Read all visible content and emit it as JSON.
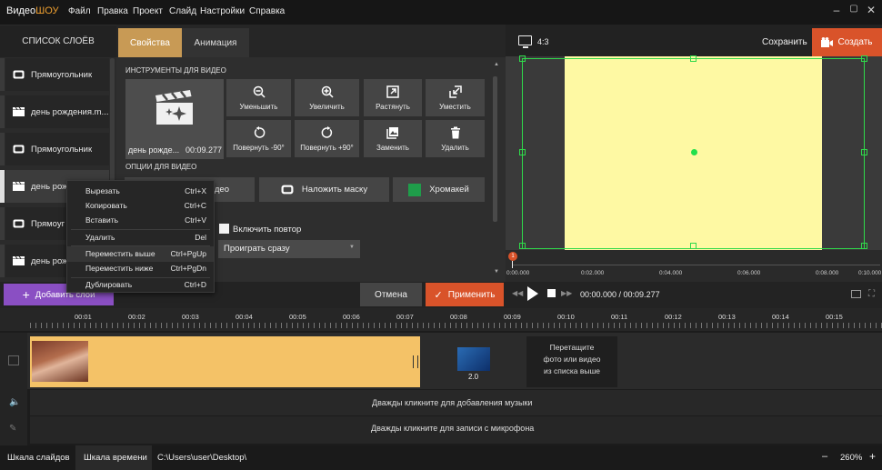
{
  "app": {
    "brand_part1": "Видео",
    "brand_part2": "ШОУ"
  },
  "menu": [
    "Файл",
    "Правка",
    "Проект",
    "Слайд",
    "Настройки",
    "Справка"
  ],
  "layers": {
    "title": "СПИСОК СЛОЁВ",
    "items": [
      {
        "label": "Прямоугольник",
        "icon": "rectangle-icon"
      },
      {
        "label": "день рождения.m...",
        "icon": "clapperboard-icon"
      },
      {
        "label": "Прямоугольник",
        "icon": "rectangle-icon"
      },
      {
        "label": "день рож",
        "icon": "clapperboard-icon"
      },
      {
        "label": "Прямоуг",
        "icon": "rectangle-icon"
      },
      {
        "label": "день рож",
        "icon": "clapperboard-icon"
      }
    ]
  },
  "tabs": {
    "properties": "Свойства",
    "animation": "Анимация"
  },
  "video_tools": {
    "title": "ИНСТРУМЕНТЫ ДЛЯ ВИДЕО",
    "clip_name": "день рожде...",
    "clip_time": "00:09.277",
    "buttons": [
      {
        "label": "Уменьшить",
        "icon": "zoom-out-icon"
      },
      {
        "label": "Увеличить",
        "icon": "zoom-in-icon"
      },
      {
        "label": "Растянуть",
        "icon": "stretch-icon"
      },
      {
        "label": "Уместить",
        "icon": "fit-icon"
      },
      {
        "label": "Повернуть -90°",
        "icon": "rotate-left-icon"
      },
      {
        "label": "Повернуть +90°",
        "icon": "rotate-right-icon"
      },
      {
        "label": "Заменить",
        "icon": "replace-icon"
      },
      {
        "label": "Удалить",
        "icon": "trash-icon"
      }
    ]
  },
  "video_options": {
    "title": "ОПЦИИ ДЛЯ ВИДЕО",
    "btn1_partial": "идео",
    "mask_label": "Наложить маску",
    "chroma_label": "Хромакей",
    "loop_label": "Включить повтор",
    "play_select": "Проиграть сразу"
  },
  "context_menu": [
    {
      "label": "Вырезать",
      "shortcut": "Ctrl+X"
    },
    {
      "label": "Копировать",
      "shortcut": "Ctrl+C"
    },
    {
      "label": "Вставить",
      "shortcut": "Ctrl+V"
    },
    {
      "label": "Удалить",
      "shortcut": "Del"
    },
    {
      "label": "Переместить выше",
      "shortcut": "Ctrl+PgUp"
    },
    {
      "label": "Переместить ниже",
      "shortcut": "Ctrl+PgDn"
    },
    {
      "label": "Дублировать",
      "shortcut": "Ctrl+D"
    }
  ],
  "preview": {
    "aspect": "4:3",
    "save": "Сохранить",
    "create": "Создать",
    "playhead_badge": "1",
    "ruler_times": [
      "0:00.000",
      "0:02.000",
      "0:04.000",
      "0:06.000",
      "0:08.000",
      "0:10.000"
    ]
  },
  "actions": {
    "add_slide": "Добавить слой",
    "cancel": "Отмена",
    "apply": "Применить",
    "time": "00:00.000 / 00:09.277"
  },
  "timeline": {
    "ticks": [
      "00:01",
      "00:02",
      "00:03",
      "00:04",
      "00:05",
      "00:06",
      "00:07",
      "00:08",
      "00:09",
      "00:10",
      "00:11",
      "00:12",
      "00:13",
      "00:14",
      "00:15"
    ],
    "transition_duration": "2.0",
    "drop_hint_1": "Перетащите",
    "drop_hint_2": "фото или видео",
    "drop_hint_3": "из списка выше",
    "music_hint": "Дважды кликните для добавления музыки",
    "mic_hint": "Дважды кликните для записи с микрофона"
  },
  "status": {
    "tab_slides": "Шкала слайдов",
    "tab_timeline": "Шкала времени",
    "path": "C:\\Users\\user\\Desktop\\",
    "zoom": "260%"
  },
  "colors": {
    "accent": "#d9532a",
    "tab_active": "#c89a55",
    "add_button": "#8a4fc3",
    "selection": "#2fd94a",
    "canvas": "#fef9a3",
    "clip": "#f4c267"
  }
}
